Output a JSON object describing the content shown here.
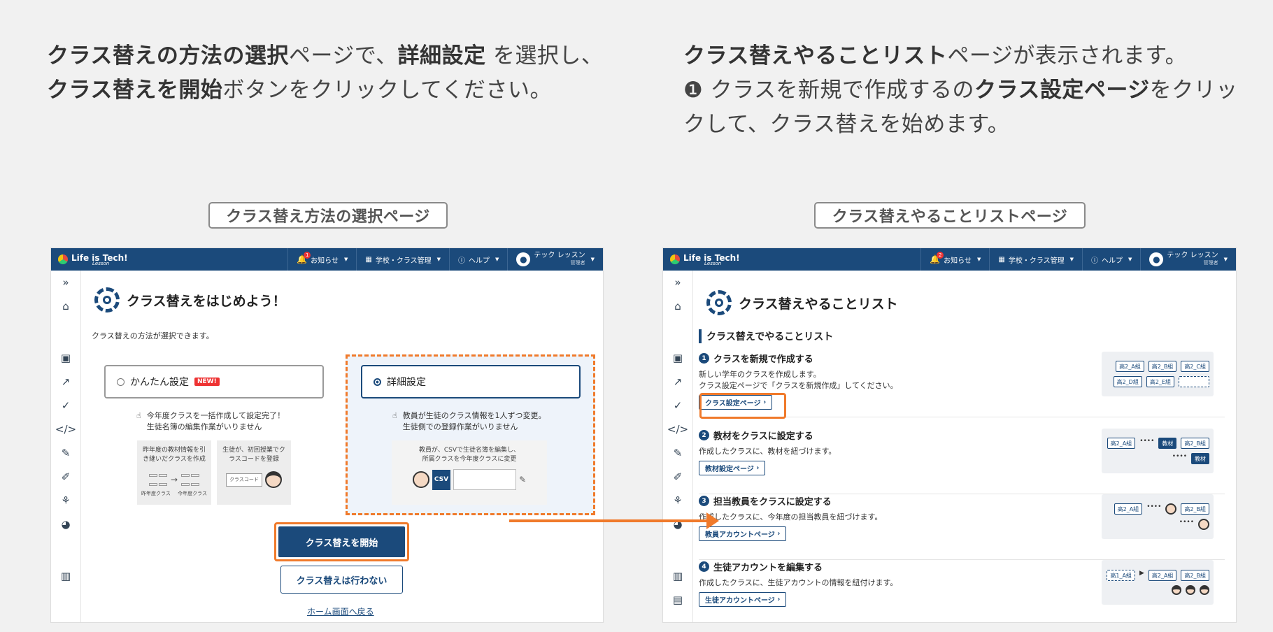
{
  "instructions": {
    "left": {
      "b1": "クラス替えの方法の選択",
      "t1": "ページで、",
      "b2": "詳細設定",
      "t2": " を選択し、",
      "b3": "クラス替えを開始",
      "t3": "ボタンをクリックしてください。"
    },
    "right": {
      "b1": "クラス替えやることリスト",
      "t1": "ページが表示されます。",
      "t2": "❶ クラスを新規で作成するの",
      "b2": "クラス設定ページ",
      "t3": "をクリックして、クラス替えを始めます。"
    }
  },
  "captions": {
    "left": "クラス替え方法の選択ページ",
    "right": "クラス替えやることリストページ"
  },
  "header": {
    "logo": "Life is Tech!",
    "logo_sub": "Lesson",
    "notice": "お知らせ",
    "notice_count": "1",
    "notice_count_right": "2",
    "school": "学校・クラス管理",
    "help": "ヘルプ",
    "user_name": "テック レッスン",
    "user_role": "管理者"
  },
  "left_page": {
    "title": "クラス替えをはじめよう！",
    "desc": "クラス替えの方法が選択できます。",
    "option_easy": {
      "label": "かんたん設定",
      "badge": "NEW!",
      "desc1": "今年度クラスを一括作成して設定完了！",
      "desc2": "生徒名簿の編集作業がいりません",
      "card1": "昨年度の教材情報を引き継いだクラスを作成",
      "card1_from": "昨年度クラス",
      "card1_to": "今年度クラス",
      "card2": "生徒が、初回授業でクラスコードを登録",
      "card2_label": "クラスコード"
    },
    "option_detail": {
      "label": "詳細設定",
      "desc1": "教員が生徒のクラス情報を1人ずつ変更。",
      "desc2": "生徒側での登録作業がいりません",
      "card": "教員が、CSVで生徒名簿を編集し、所属クラスを今年度クラスに変更",
      "csv": "CSV"
    },
    "start_button": "クラス替えを開始",
    "cancel_button": "クラス替えは行わない",
    "home_link": "ホーム画面へ戻る"
  },
  "right_page": {
    "title": "クラス替えやることリスト",
    "subtitle": "クラス替えでやることリスト",
    "steps": [
      {
        "num": "1",
        "title": "クラスを新規で作成する",
        "desc1": "新しい学年のクラスを作成します。",
        "desc2": "クラス設定ページで「クラスを新規作成」してください。",
        "button": "クラス設定ページ"
      },
      {
        "num": "2",
        "title": "教材をクラスに設定する",
        "desc1": "作成したクラスに、教材を紐づけます。",
        "desc2": "",
        "button": "教材設定ページ"
      },
      {
        "num": "3",
        "title": "担当教員をクラスに設定する",
        "desc1": "作成したクラスに、今年度の担当教員を紐づけます。",
        "desc2": "",
        "button": "教員アカウントページ"
      },
      {
        "num": "4",
        "title": "生徒アカウントを編集する",
        "desc1": "作成したクラスに、生徒アカウントの情報を紐付けます。",
        "desc2": "",
        "button": "生徒アカウントページ"
      }
    ],
    "chips": {
      "a": "高2_A組",
      "b": "高2_B組",
      "c": "高2_C組",
      "d": "高2_D組",
      "e": "高2_E組",
      "old": "高1_A組",
      "material": "教材"
    }
  },
  "colors": {
    "brand": "#1b4a7b",
    "highlight": "#f07a2b"
  }
}
